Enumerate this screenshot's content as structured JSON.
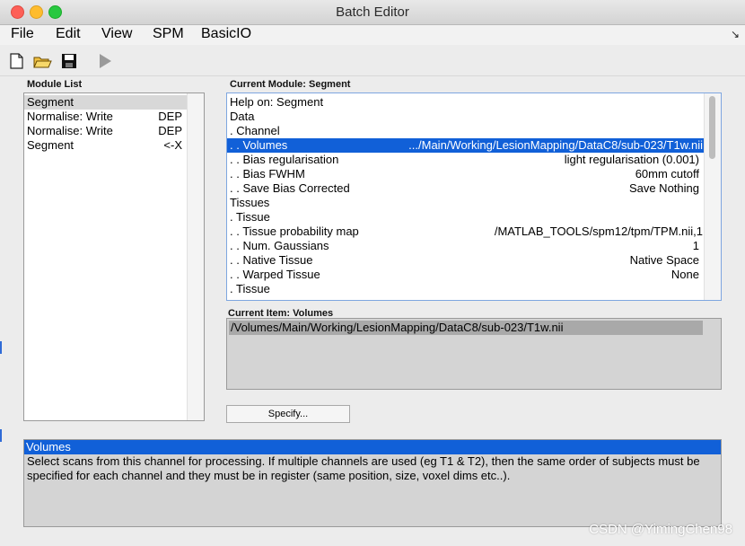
{
  "window": {
    "title": "Batch Editor"
  },
  "menubar": {
    "items": [
      "File",
      "Edit",
      "View",
      "SPM",
      "BasicIO"
    ],
    "overflow_glyph": "↘"
  },
  "toolbar": {
    "icons": [
      "new-file-icon",
      "open-folder-icon",
      "save-icon",
      "run-icon"
    ]
  },
  "module_list": {
    "label": "Module List",
    "items": [
      {
        "name": "Segment",
        "tag": ""
      },
      {
        "name": "Normalise: Write",
        "tag": "DEP"
      },
      {
        "name": "Normalise: Write",
        "tag": "DEP"
      },
      {
        "name": "Segment",
        "tag": "<-X"
      }
    ]
  },
  "current_module": {
    "label": "Current Module: Segment",
    "rows": [
      {
        "name": "Help on: Segment",
        "value": ""
      },
      {
        "name": "Data",
        "value": ""
      },
      {
        "name": " . Channel",
        "value": ""
      },
      {
        "name": " . . Volumes",
        "value": ".../Main/Working/LesionMapping/DataC8/sub-023/T1w.nii"
      },
      {
        "name": " . . Bias regularisation",
        "value": "light regularisation (0.001)"
      },
      {
        "name": " . . Bias FWHM",
        "value": "60mm cutoff"
      },
      {
        "name": " . . Save Bias Corrected",
        "value": "Save Nothing"
      },
      {
        "name": "Tissues",
        "value": ""
      },
      {
        "name": " . Tissue",
        "value": ""
      },
      {
        "name": " . . Tissue probability map",
        "value": "/MATLAB_TOOLS/spm12/tpm/TPM.nii,1"
      },
      {
        "name": " . . Num. Gaussians",
        "value": "1"
      },
      {
        "name": " . . Native Tissue",
        "value": "Native Space"
      },
      {
        "name": " . . Warped Tissue",
        "value": "None"
      },
      {
        "name": " . Tissue",
        "value": ""
      }
    ]
  },
  "current_item": {
    "label": "Current Item: Volumes",
    "value": "/Volumes/Main/Working/LesionMapping/DataC8/sub-023/T1w.nii",
    "button": "Specify..."
  },
  "help": {
    "title": "Volumes",
    "text": "Select  scans  from this channel for processing. If multiple channels are used (eg T1 & T2), then the same order of subjects must be specified for each channel and they must be in register (same position, size, voxel dims etc..)."
  },
  "watermark": "CSDN @YimingChen98",
  "colors": {
    "selection_blue": "#1160d8",
    "panel_gray": "#d4d4d4",
    "window_bg": "#ececec"
  }
}
